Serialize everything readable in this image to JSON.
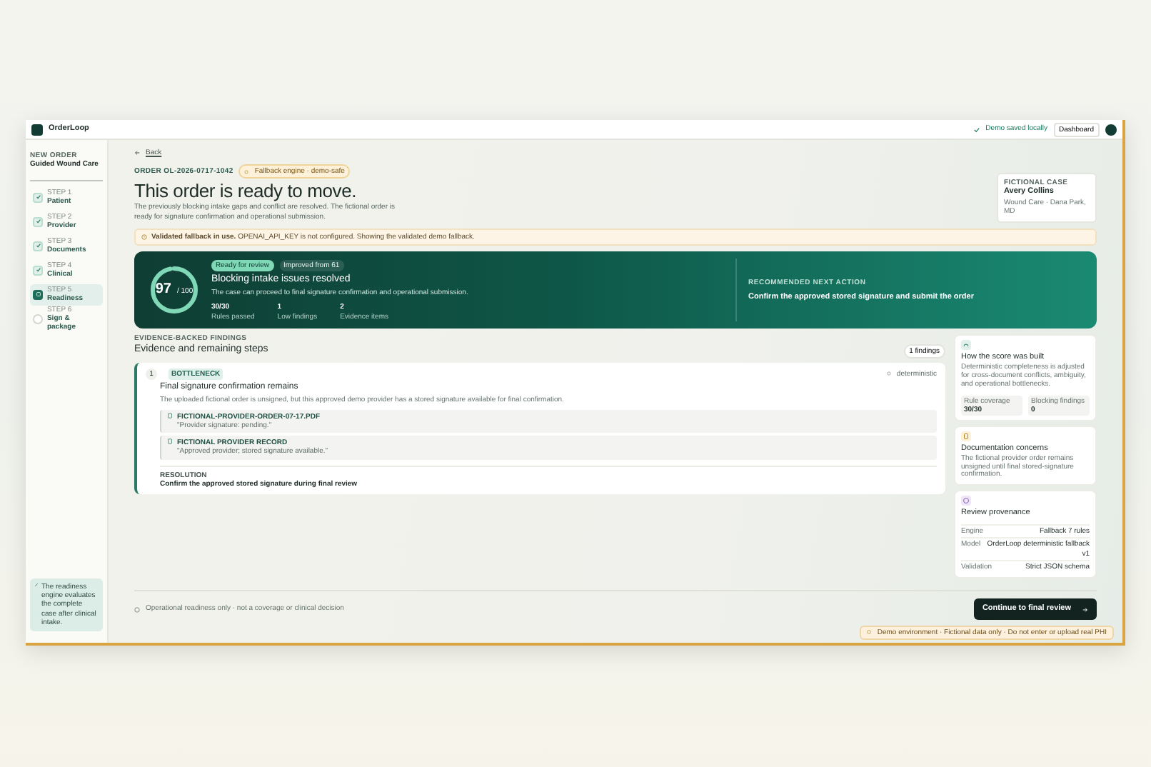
{
  "app": {
    "name": "OrderLoop",
    "saved": "Demo saved locally",
    "dashboard": "Dashboard"
  },
  "sidebar": {
    "eyebrow": "NEW ORDER",
    "title": "Guided Wound Care",
    "steps": [
      {
        "step": "STEP 1",
        "label": "Patient",
        "completed": true,
        "selected": false
      },
      {
        "step": "STEP 2",
        "label": "Provider",
        "completed": true,
        "selected": false
      },
      {
        "step": "STEP 3",
        "label": "Documents",
        "completed": true,
        "selected": false
      },
      {
        "step": "STEP 4",
        "label": "Clinical",
        "completed": true,
        "selected": false
      },
      {
        "step": "STEP 5",
        "label": "Readiness",
        "completed": false,
        "selected": true
      },
      {
        "step": "STEP 6",
        "label": "Sign & package",
        "completed": false,
        "selected": false
      }
    ],
    "note": "The readiness engine evaluates the complete case after clinical intake."
  },
  "back": "Back",
  "order_id": "ORDER OL-2026-0717-1042",
  "engine_badge": "Fallback engine · demo-safe",
  "headline": "This order is ready to move.",
  "intro": "The previously blocking intake gaps and conflict are resolved. The fictional order is ready for signature confirmation and operational submission.",
  "patient": {
    "eyebrow": "FICTIONAL CASE",
    "name": "Avery Collins",
    "detail": "Wound Care · Dana Park, MD"
  },
  "alert": "**Validated fallback in use.** OPENAI_API_KEY is not configured. Showing the validated demo fallback.",
  "hero": {
    "score": "97",
    "out_of": "/ 100",
    "level": 0.97,
    "pills": [
      "Ready for review",
      "Improved from 61"
    ],
    "title": "Blocking intake issues resolved",
    "subtitle": "The case can proceed to final signature confirmation and operational submission.",
    "stats": [
      {
        "value": "30/30",
        "label": "Rules passed"
      },
      {
        "value": "1",
        "label": "Low findings"
      },
      {
        "value": "2",
        "label": "Evidence items"
      }
    ],
    "next_eyebrow": "RECOMMENDED NEXT ACTION",
    "next_action": "Confirm the approved stored signature and submit the order"
  },
  "findings": {
    "eyebrow": "EVIDENCE-BACKED FINDINGS",
    "title": "Evidence and remaining steps",
    "count": "1 findings",
    "items": [
      {
        "number": "1",
        "tag": "BOTTLENECK",
        "source": "deterministic",
        "title": "Final signature confirmation remains",
        "description": "The uploaded fictional order is unsigned, but this approved demo provider has a stored signature available for final confirmation.",
        "evidence": [
          {
            "file": "FICTIONAL-PROVIDER-ORDER-07-17.PDF",
            "quote": "\"Provider signature: pending.\""
          },
          {
            "file": "FICTIONAL PROVIDER RECORD",
            "quote": "\"Approved provider; stored signature available.\""
          }
        ],
        "resolution_label": "RESOLUTION",
        "resolution": "Confirm the approved stored signature during final review"
      }
    ]
  },
  "side_cards": [
    {
      "kind": "score",
      "title": "How the score was built",
      "text": "Deterministic completeness is adjusted for cross-document conflicts, ambiguity, and operational bottlenecks.",
      "stats": [
        {
          "label": "Rule coverage",
          "value": "30/30"
        },
        {
          "label": "Blocking findings",
          "value": "0"
        }
      ]
    },
    {
      "kind": "concerns",
      "title": "Documentation concerns",
      "text": "The fictional provider order remains unsigned until final stored-signature confirmation."
    },
    {
      "kind": "provenance",
      "title": "Review provenance",
      "rows": [
        {
          "label": "Engine",
          "value": "Fallback 7 rules"
        },
        {
          "label": "Model",
          "value": "OrderLoop deterministic fallback v1"
        },
        {
          "label": "Validation",
          "value": "Strict JSON schema"
        }
      ]
    }
  ],
  "footer_note": "Operational readiness only · not a coverage or clinical decision",
  "continue": "Continue to final review",
  "toast": "Demo environment · Fictional data only · Do not enter or upload real PHI"
}
